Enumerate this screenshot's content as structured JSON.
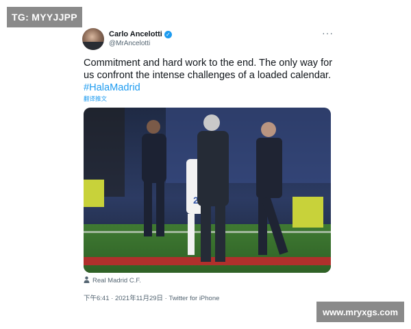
{
  "watermarks": {
    "top_left": "TG: MYYJJPP",
    "bottom_right": "www.mryxgs.com"
  },
  "tweet": {
    "display_name": "Carlo Ancelotti",
    "handle": "@MrAncelotti",
    "more_icon": "more-horizontal-icon",
    "verified_icon": "verified-badge-icon",
    "text_main": "Commitment and hard work to the end. The only way for us confront the intense challenges of a loaded calendar.",
    "hashtag": "#HalaMadrid",
    "translate_label": "翻译推文",
    "location": "Real Madrid C.F.",
    "location_icon": "person-icon",
    "time": "下午6:41",
    "date": "2021年11月29日",
    "source": "Twitter for iPhone",
    "meta_separator": " · ",
    "link_color": "#1d9bf0"
  }
}
